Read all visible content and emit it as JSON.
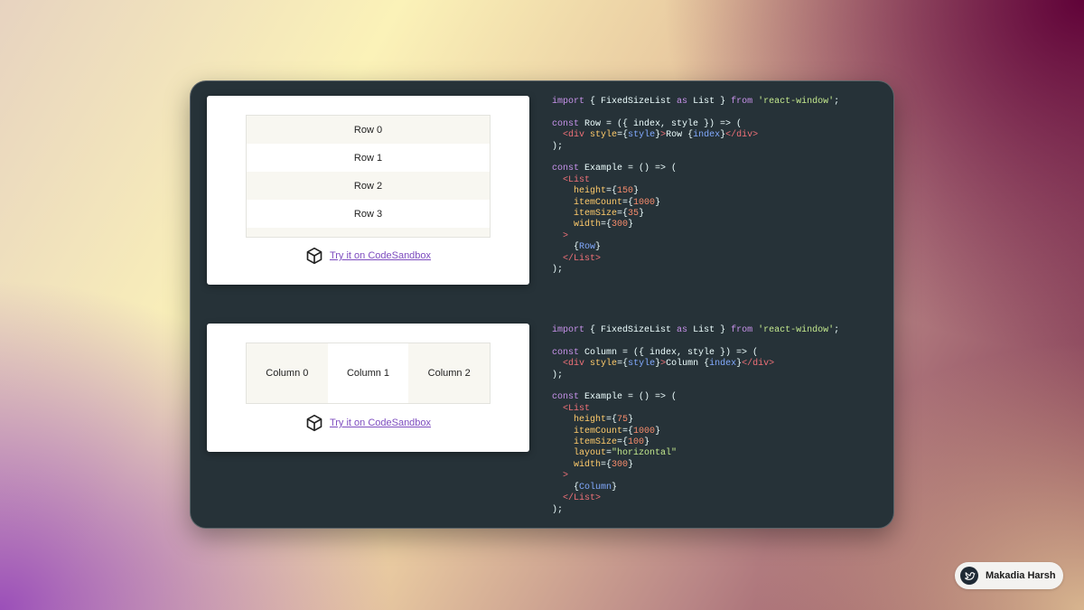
{
  "row_list": {
    "rows": [
      "Row 0",
      "Row 1",
      "Row 2",
      "Row 3"
    ],
    "link_label": "Try it on CodeSandbox"
  },
  "column_list": {
    "columns": [
      "Column 0",
      "Column 1",
      "Column 2"
    ],
    "link_label": "Try it on CodeSandbox"
  },
  "code_rows": [
    [
      [
        "kw",
        "import"
      ],
      [
        "p",
        " { FixedSizeList "
      ],
      [
        "kw",
        "as"
      ],
      [
        "p",
        " List } "
      ],
      [
        "kw",
        "from"
      ],
      [
        "p",
        " "
      ],
      [
        "str",
        "'react-window'"
      ],
      [
        "p",
        ";"
      ]
    ],
    [],
    [
      [
        "kw",
        "const"
      ],
      [
        "p",
        " Row = ({ index, style }) => ("
      ]
    ],
    [
      [
        "p",
        "  "
      ],
      [
        "tag",
        "<div"
      ],
      [
        "p",
        " "
      ],
      [
        "attr",
        "style"
      ],
      [
        "p",
        "={"
      ],
      [
        "vr",
        "style"
      ],
      [
        "p",
        "}"
      ],
      [
        "tag",
        ">"
      ],
      [
        "p",
        "Row {"
      ],
      [
        "vr",
        "index"
      ],
      [
        "p",
        "}"
      ],
      [
        "tag",
        "</div>"
      ]
    ],
    [
      [
        "p",
        ");"
      ]
    ],
    [],
    [
      [
        "kw",
        "const"
      ],
      [
        "p",
        " Example = () => ("
      ]
    ],
    [
      [
        "p",
        "  "
      ],
      [
        "tag",
        "<List"
      ]
    ],
    [
      [
        "p",
        "    "
      ],
      [
        "attr",
        "height"
      ],
      [
        "p",
        "={"
      ],
      [
        "num",
        "150"
      ],
      [
        "p",
        "}"
      ]
    ],
    [
      [
        "p",
        "    "
      ],
      [
        "attr",
        "itemCount"
      ],
      [
        "p",
        "={"
      ],
      [
        "num",
        "1000"
      ],
      [
        "p",
        "}"
      ]
    ],
    [
      [
        "p",
        "    "
      ],
      [
        "attr",
        "itemSize"
      ],
      [
        "p",
        "={"
      ],
      [
        "num",
        "35"
      ],
      [
        "p",
        "}"
      ]
    ],
    [
      [
        "p",
        "    "
      ],
      [
        "attr",
        "width"
      ],
      [
        "p",
        "={"
      ],
      [
        "num",
        "300"
      ],
      [
        "p",
        "}"
      ]
    ],
    [
      [
        "p",
        "  "
      ],
      [
        "tag",
        ">"
      ]
    ],
    [
      [
        "p",
        "    {"
      ],
      [
        "vr",
        "Row"
      ],
      [
        "p",
        "}"
      ]
    ],
    [
      [
        "p",
        "  "
      ],
      [
        "tag",
        "</List>"
      ]
    ],
    [
      [
        "p",
        ");"
      ]
    ]
  ],
  "code_columns": [
    [
      [
        "kw",
        "import"
      ],
      [
        "p",
        " { FixedSizeList "
      ],
      [
        "kw",
        "as"
      ],
      [
        "p",
        " List } "
      ],
      [
        "kw",
        "from"
      ],
      [
        "p",
        " "
      ],
      [
        "str",
        "'react-window'"
      ],
      [
        "p",
        ";"
      ]
    ],
    [],
    [
      [
        "kw",
        "const"
      ],
      [
        "p",
        " Column = ({ index, style }) => ("
      ]
    ],
    [
      [
        "p",
        "  "
      ],
      [
        "tag",
        "<div"
      ],
      [
        "p",
        " "
      ],
      [
        "attr",
        "style"
      ],
      [
        "p",
        "={"
      ],
      [
        "vr",
        "style"
      ],
      [
        "p",
        "}"
      ],
      [
        "tag",
        ">"
      ],
      [
        "p",
        "Column {"
      ],
      [
        "vr",
        "index"
      ],
      [
        "p",
        "}"
      ],
      [
        "tag",
        "</div>"
      ]
    ],
    [
      [
        "p",
        ");"
      ]
    ],
    [],
    [
      [
        "kw",
        "const"
      ],
      [
        "p",
        " Example = () => ("
      ]
    ],
    [
      [
        "p",
        "  "
      ],
      [
        "tag",
        "<List"
      ]
    ],
    [
      [
        "p",
        "    "
      ],
      [
        "attr",
        "height"
      ],
      [
        "p",
        "={"
      ],
      [
        "num",
        "75"
      ],
      [
        "p",
        "}"
      ]
    ],
    [
      [
        "p",
        "    "
      ],
      [
        "attr",
        "itemCount"
      ],
      [
        "p",
        "={"
      ],
      [
        "num",
        "1000"
      ],
      [
        "p",
        "}"
      ]
    ],
    [
      [
        "p",
        "    "
      ],
      [
        "attr",
        "itemSize"
      ],
      [
        "p",
        "={"
      ],
      [
        "num",
        "100"
      ],
      [
        "p",
        "}"
      ]
    ],
    [
      [
        "p",
        "    "
      ],
      [
        "attr",
        "layout"
      ],
      [
        "p",
        "="
      ],
      [
        "str",
        "\"horizontal\""
      ]
    ],
    [
      [
        "p",
        "    "
      ],
      [
        "attr",
        "width"
      ],
      [
        "p",
        "={"
      ],
      [
        "num",
        "300"
      ],
      [
        "p",
        "}"
      ]
    ],
    [
      [
        "p",
        "  "
      ],
      [
        "tag",
        ">"
      ]
    ],
    [
      [
        "p",
        "    {"
      ],
      [
        "vr",
        "Column"
      ],
      [
        "p",
        "}"
      ]
    ],
    [
      [
        "p",
        "  "
      ],
      [
        "tag",
        "</List>"
      ]
    ],
    [
      [
        "p",
        ");"
      ]
    ]
  ],
  "author": {
    "name": "Makadia Harsh",
    "icon": "bird-logo-icon"
  },
  "colors": {
    "panel_bg": "#263238",
    "keyword": "#c792ea",
    "string": "#c3e88d",
    "tag": "#f07178",
    "attribute": "#ffcb6b",
    "number": "#f78c6c",
    "variable": "#82aaff",
    "link": "#7d4cbf"
  }
}
